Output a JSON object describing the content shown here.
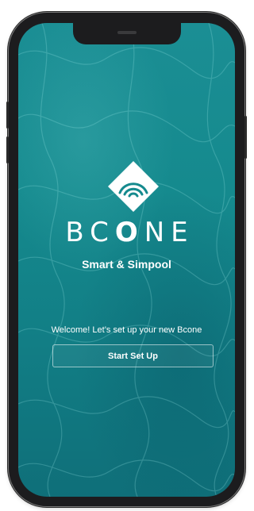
{
  "brand": {
    "name_prefix": "BC",
    "name_o": "O",
    "name_suffix": "NE",
    "tagline": "Smart & Simpool"
  },
  "onboarding": {
    "welcome_text": "Welcome! Let’s set up your new Bcone",
    "start_button_label": "Start Set Up"
  },
  "colors": {
    "screen_background": "#158a8e",
    "text": "#ffffff",
    "device_frame": "#1c1c1e"
  },
  "icons": {
    "logo": "wifi-diamond-logo-icon"
  }
}
